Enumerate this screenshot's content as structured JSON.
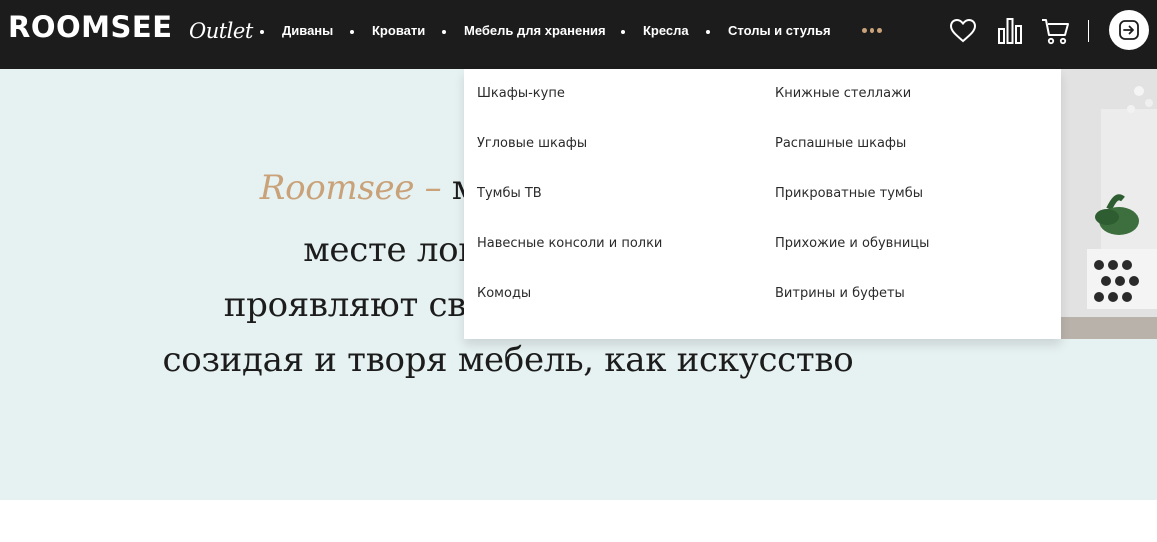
{
  "header": {
    "logo": "ROOMSEE",
    "outlet": "Outlet",
    "nav": [
      "Диваны",
      "Кровати",
      "Мебель для хранения",
      "Кресла",
      "Столы и стулья"
    ],
    "icons": [
      "heart-icon",
      "compare-icon",
      "cart-icon",
      "login-icon"
    ]
  },
  "dropdown": {
    "col1": [
      "Шкафы-купе",
      "Угловые шкафы",
      "Тумбы ТВ",
      "Навесные консоли и полки",
      "Комоды"
    ],
    "col2": [
      "Книжные стеллажи",
      "Распашные шкафы",
      "Прикроватные тумбы",
      "Прихожие и обувницы",
      "Витрины и буфеты"
    ]
  },
  "hero": {
    "brand": "Roomsee –",
    "line1_rest": " марке",
    "line2": "месте локальных",
    "line3": "проявляют свое вдо",
    "line4": "созидая и творя мебель, как искусство"
  },
  "colors": {
    "header_bg": "#1c1c1c",
    "hero_bg": "#e6f1f1",
    "accent": "#c9a27a"
  }
}
